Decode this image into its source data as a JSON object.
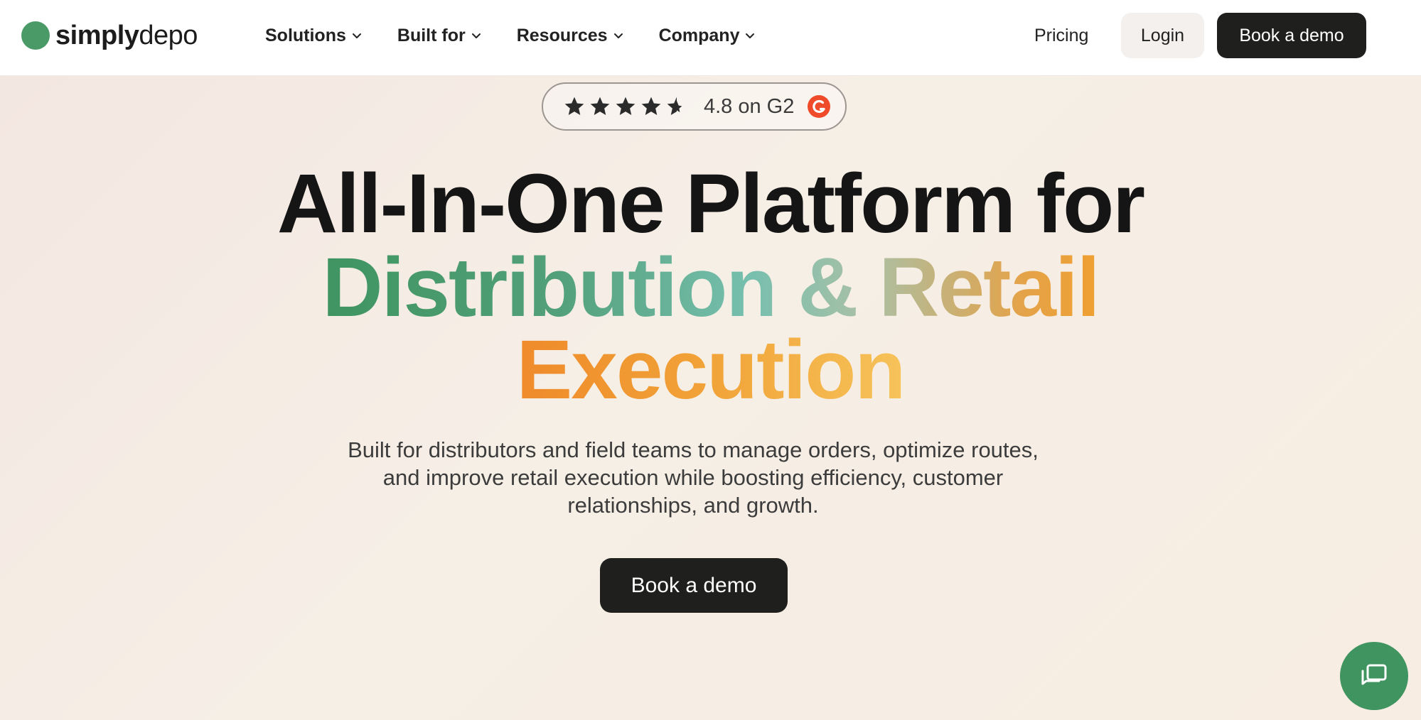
{
  "brand": {
    "name_bold": "simply",
    "name_light": "depo",
    "accent": "#4a9a68"
  },
  "nav": {
    "menu": [
      {
        "label": "Solutions"
      },
      {
        "label": "Built for"
      },
      {
        "label": "Resources"
      },
      {
        "label": "Company"
      }
    ],
    "pricing": "Pricing",
    "login": "Login",
    "book_demo": "Book a demo"
  },
  "rating": {
    "value": 4.5,
    "max_stars": 5,
    "text": "4.8 on G2",
    "badge_icon": "g2-icon",
    "badge_color": "#ef4a2a"
  },
  "hero": {
    "line1": "All-In-One Platform for",
    "line2": "Distribution & Retail",
    "line3": "Execution",
    "subtitle": "Built for distributors and field teams to manage orders, optimize routes, and improve retail execution while boosting efficiency, customer relationships, and growth.",
    "cta": "Book a demo"
  },
  "chat": {
    "icon": "chat-icon",
    "color": "#3f9460"
  }
}
